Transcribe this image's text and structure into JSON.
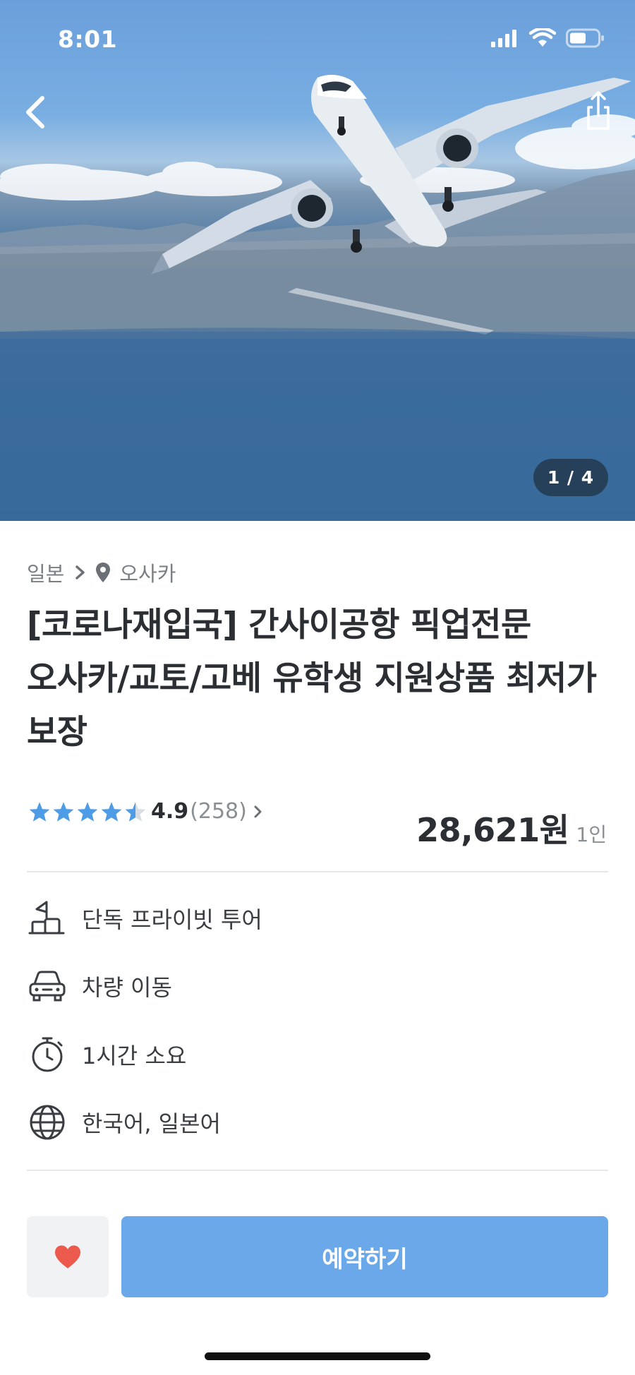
{
  "status_bar": {
    "time": "8:01"
  },
  "hero": {
    "counter": "1 / 4"
  },
  "breadcrumb": {
    "country": "일본",
    "city": "오사카"
  },
  "product": {
    "title": "[코로나재입국]  간사이공항  픽업전문  오사카/교토/고베 유학생 지원상품 최저가 보장",
    "rating": 4.9,
    "rating_text": "4.9",
    "review_count": "(258)",
    "price": "28,621원",
    "price_unit": "1인"
  },
  "features": [
    {
      "icon": "private-tour-icon",
      "label": "단독 프라이빗 투어"
    },
    {
      "icon": "car-icon",
      "label": "차량 이동"
    },
    {
      "icon": "timer-icon",
      "label": "1시간 소요"
    },
    {
      "icon": "globe-icon",
      "label": "한국어, 일본어"
    }
  ],
  "actions": {
    "book_label": "예약하기"
  },
  "colors": {
    "accent": "#6aa8ea",
    "star": "#4e9be6",
    "heart": "#ec5a4d",
    "text_dark": "#2b2f33",
    "text_muted": "#7a7f85"
  }
}
